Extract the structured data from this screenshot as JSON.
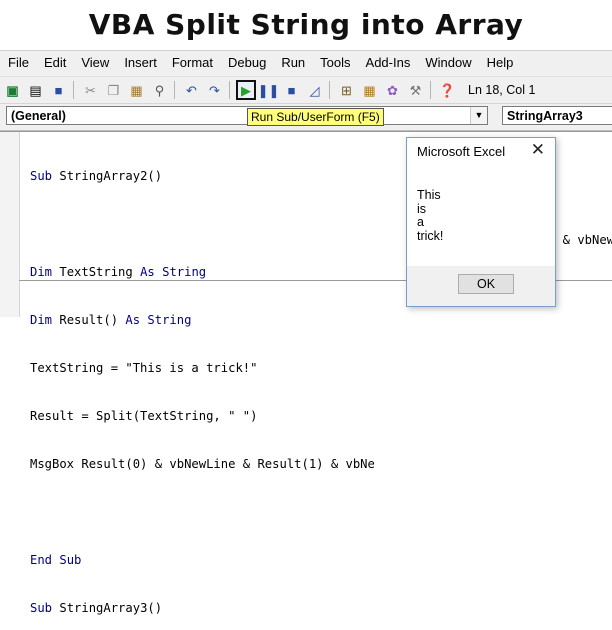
{
  "page_title": "VBA Split String into Array",
  "menu": [
    "File",
    "Edit",
    "View",
    "Insert",
    "Format",
    "Debug",
    "Run",
    "Tools",
    "Add-Ins",
    "Window",
    "Help"
  ],
  "status": {
    "lncol": "Ln 18, Col 1"
  },
  "codebar": {
    "object_combo": "(General)",
    "proc_combo": "StringArray3",
    "tooltip": "Run Sub/UserForm (F5)"
  },
  "code_lines": [
    "Sub StringArray2()",
    "",
    "Dim TextString As String",
    "Dim Result() As String",
    "TextString = \"This is a trick!\"",
    "Result = Split(TextString, \" \")",
    "MsgBox Result(0) & vbNewLine & Result(1) & vbNe",
    "",
    "End Sub",
    "Sub StringArray3()"
  ],
  "code_clipped_right": ") & vbNewL",
  "msgbox": {
    "title": "Microsoft Excel",
    "close_glyph": "✕",
    "lines": [
      "This",
      "is",
      "a",
      "trick!"
    ],
    "ok_label": "OK"
  }
}
